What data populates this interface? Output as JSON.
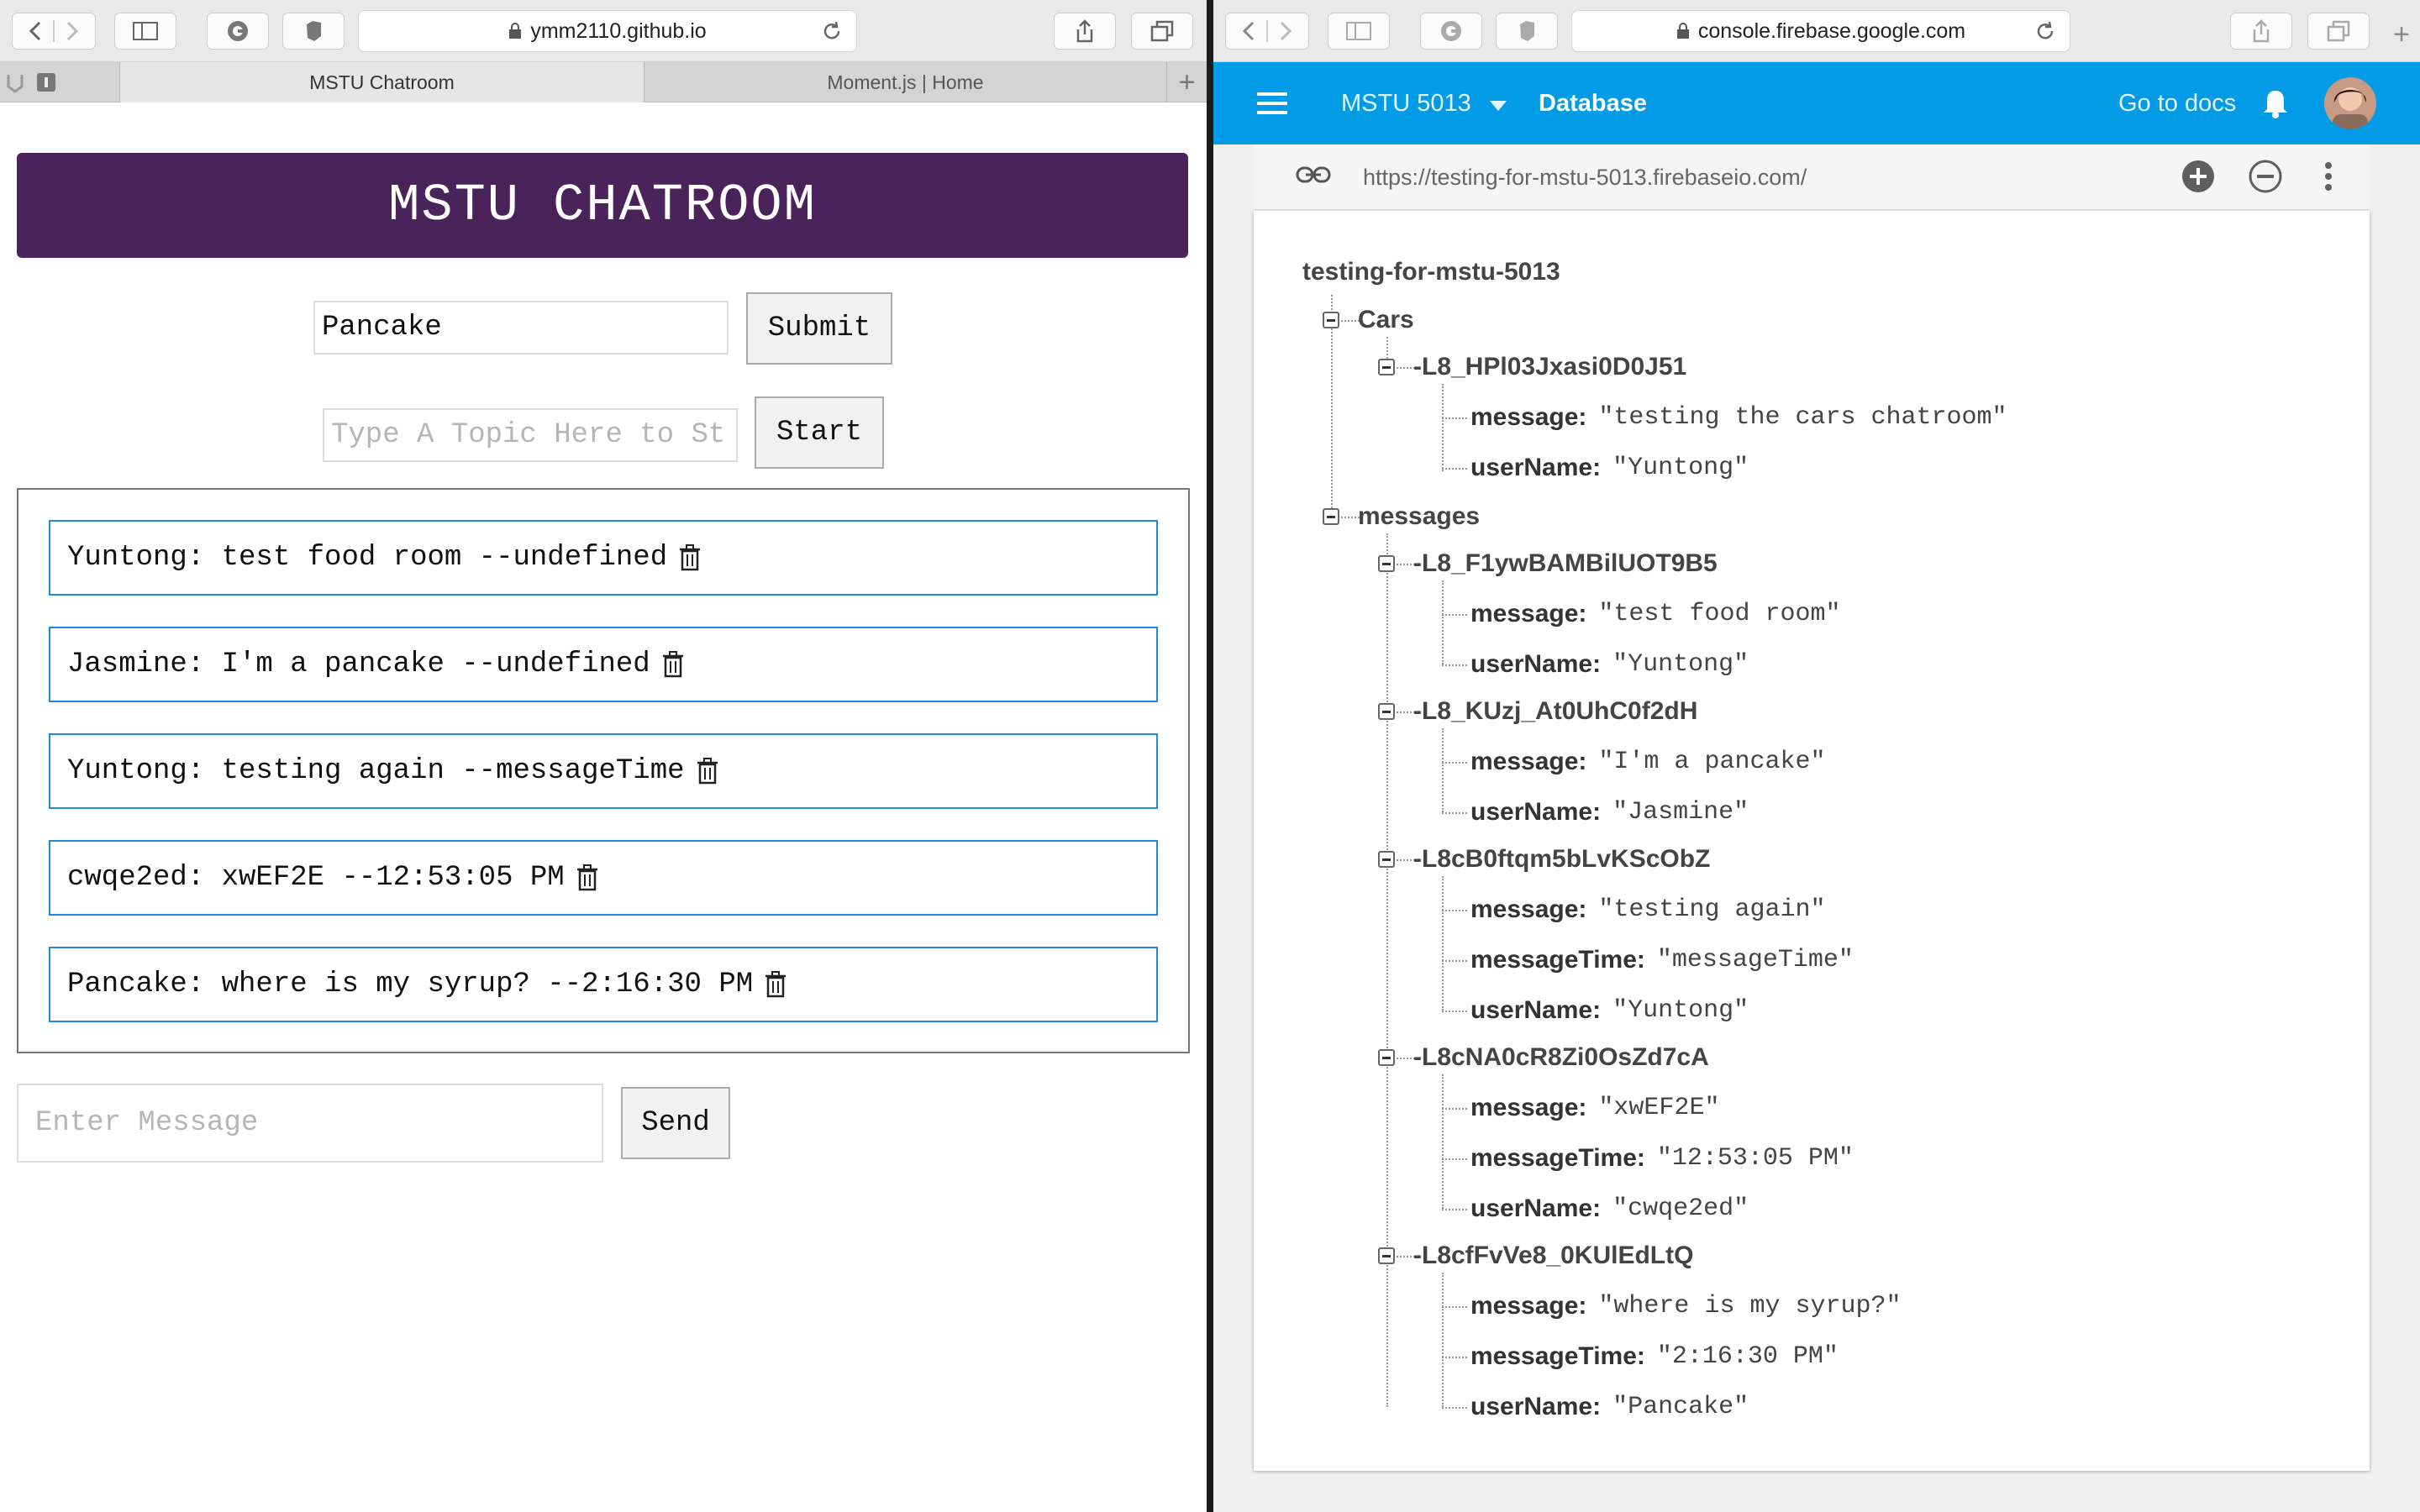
{
  "left_browser": {
    "address": "ymm2110.github.io",
    "tabs": [
      {
        "label": "MSTU Chatroom",
        "active": true
      },
      {
        "label": "Moment.js | Home",
        "active": false
      }
    ]
  },
  "chat": {
    "title": "MSTU CHATROOM",
    "name_value": "Pancake",
    "submit_label": "Submit",
    "topic_placeholder": "Type A Topic Here to St",
    "start_label": "Start",
    "messages": [
      {
        "text": "Yuntong: test food room --undefined"
      },
      {
        "text": "Jasmine: I'm a pancake --undefined"
      },
      {
        "text": "Yuntong: testing again --messageTime"
      },
      {
        "text": "cwqe2ed: xwEF2E --12:53:05 PM"
      },
      {
        "text": "Pancake: where is my syrup? --2:16:30 PM"
      }
    ],
    "message_placeholder": "Enter Message",
    "send_label": "Send"
  },
  "right_browser": {
    "address": "console.firebase.google.com"
  },
  "firebase": {
    "project": "MSTU 5013",
    "section": "Database",
    "docs_label": "Go to docs",
    "db_url": "https://testing-for-mstu-5013.firebaseio.com/",
    "root": "testing-for-mstu-5013",
    "cars_key": "Cars",
    "cars_entry": {
      "id": "-L8_HPl03Jxasi0D0J51",
      "message_label": "message:",
      "message": "\"testing the cars chatroom\"",
      "user_label": "userName:",
      "user": "\"Yuntong\""
    },
    "messages_key": "messages",
    "entries": [
      {
        "id": "-L8_F1ywBAMBilUOT9B5",
        "fields": [
          {
            "k": "message:",
            "v": "\"test food room\""
          },
          {
            "k": "userName:",
            "v": "\"Yuntong\""
          }
        ]
      },
      {
        "id": "-L8_KUzj_At0UhC0f2dH",
        "fields": [
          {
            "k": "message:",
            "v": "\"I'm a pancake\""
          },
          {
            "k": "userName:",
            "v": "\"Jasmine\""
          }
        ]
      },
      {
        "id": "-L8cB0ftqm5bLvKScObZ",
        "fields": [
          {
            "k": "message:",
            "v": "\"testing again\""
          },
          {
            "k": "messageTime:",
            "v": "\"messageTime\""
          },
          {
            "k": "userName:",
            "v": "\"Yuntong\""
          }
        ]
      },
      {
        "id": "-L8cNA0cR8Zi0OsZd7cA",
        "fields": [
          {
            "k": "message:",
            "v": "\"xwEF2E\""
          },
          {
            "k": "messageTime:",
            "v": "\"12:53:05 PM\""
          },
          {
            "k": "userName:",
            "v": "\"cwqe2ed\""
          }
        ]
      },
      {
        "id": "-L8cfFvVe8_0KUlEdLtQ",
        "fields": [
          {
            "k": "message:",
            "v": "\"where is my syrup?\""
          },
          {
            "k": "messageTime:",
            "v": "\"2:16:30 PM\""
          },
          {
            "k": "userName:",
            "v": "\"Pancake\""
          }
        ]
      }
    ]
  }
}
